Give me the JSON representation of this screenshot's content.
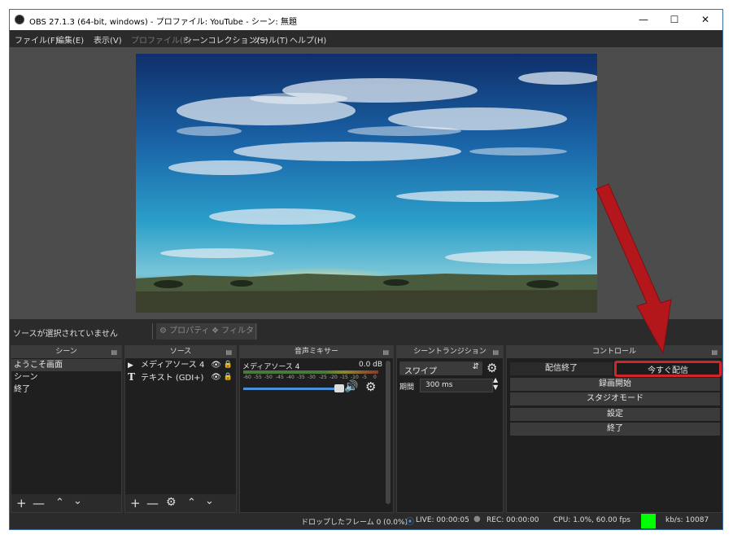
{
  "window": {
    "title": "OBS 27.1.3 (64-bit, windows) - プロファイル: YouTube - シーン: 無題"
  },
  "menu": [
    {
      "label": "ファイル(F)",
      "enabled": true
    },
    {
      "label": "編集(E)",
      "enabled": true
    },
    {
      "label": "表示(V)",
      "enabled": true
    },
    {
      "label": "プロファイル(P)",
      "enabled": false
    },
    {
      "label": "シーンコレクション(S)",
      "enabled": true
    },
    {
      "label": "ツール(T)",
      "enabled": true
    },
    {
      "label": "ヘルプ(H)",
      "enabled": true
    }
  ],
  "status_strip": {
    "no_source": "ソースが選択されていません",
    "properties": "プロパティ",
    "filters": "フィルタ"
  },
  "scenes": {
    "title": "シーン",
    "items": [
      "ようこそ画面",
      "シーン",
      "終了"
    ],
    "selected": 0
  },
  "sources": {
    "title": "ソース",
    "items": [
      {
        "icon": "play-icon",
        "label": "メディアソース 4"
      },
      {
        "icon": "text-icon",
        "label": "テキスト (GDI+)"
      }
    ]
  },
  "mixer": {
    "title": "音声ミキサー",
    "channel": "メディアソース 4",
    "db": "0.0 dB",
    "scale": [
      "-60",
      "-55",
      "-50",
      "-45",
      "-40",
      "-35",
      "-30",
      "-25",
      "-20",
      "-15",
      "-10",
      "-5",
      "0"
    ],
    "volume": 1.0
  },
  "transitions": {
    "title": "シーントランジション",
    "selected": "スワイプ",
    "duration_label": "期間",
    "duration_value": "300 ms"
  },
  "controls": {
    "title": "コントロール",
    "stop_stream": "配信終了",
    "start_stream": "今すぐ配信",
    "start_recording": "録画開始",
    "studio_mode": "スタジオモード",
    "settings": "設定",
    "exit": "終了"
  },
  "statusbar": {
    "dropped": "ドロップしたフレーム 0 (0.0%)",
    "live": "LIVE: 00:00:05",
    "rec": "REC: 00:00:00",
    "cpu": "CPU: 1.0%, 60.00 fps",
    "kbs": "kb/s: 10087"
  },
  "colors": {
    "highlight": "#d1252a",
    "stream_ok": "#00ff00",
    "annotation_arrow": "#b3171c"
  }
}
